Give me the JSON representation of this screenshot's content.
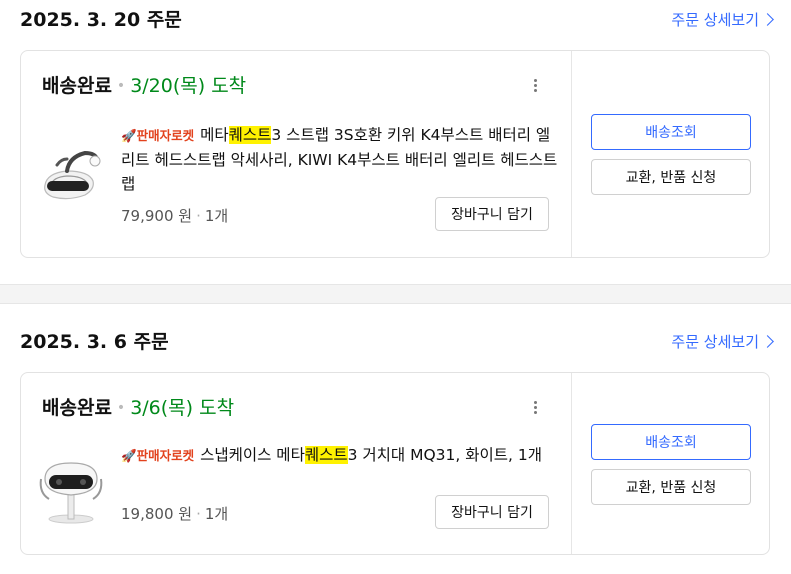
{
  "orders": [
    {
      "date": "2025. 3. 20 주문",
      "detail_link": "주문 상세보기",
      "status": "배송완료",
      "arrival": "3/20(목) 도착",
      "badge": "🚀판매자로켓",
      "title_before": "메타",
      "title_highlight": "퀘스트",
      "title_after": "3 스트랩 3S호환 키위 K4부스트 배터리 엘리트 헤드스트랩 악세사리, KIWI K4부스트 배터리 엘리트 헤드스트랩",
      "price": "79,900 원",
      "qty": "1개",
      "cart_button": "장바구니 담기",
      "track_button": "배송조회",
      "return_button": "교환, 반품 신청"
    },
    {
      "date": "2025. 3. 6 주문",
      "detail_link": "주문 상세보기",
      "status": "배송완료",
      "arrival": "3/6(목) 도착",
      "badge": "🚀판매자로켓",
      "title_before": "스냅케이스 메타",
      "title_highlight": "퀘스트",
      "title_after": "3 거치대 MQ31, 화이트, 1개",
      "price": "19,800 원",
      "qty": "1개",
      "cart_button": "장바구니 담기",
      "track_button": "배송조회",
      "return_button": "교환, 반품 신청"
    }
  ],
  "colors": {
    "accent": "#346aff",
    "delivered": "#00891a",
    "highlight": "#fff200",
    "rocket": "#e2421d"
  }
}
